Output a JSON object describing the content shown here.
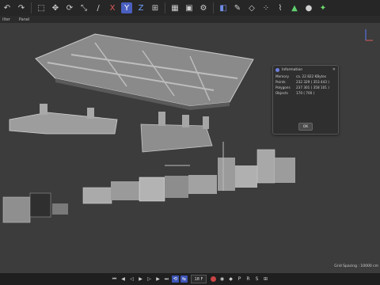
{
  "colors": {
    "toolbar_bg": "#262626",
    "viewport_bg": "#3c3c3c",
    "accent": "#4a5fbf",
    "record": "#c94444"
  },
  "toolbar": {
    "icons": [
      "undo-icon",
      "redo-icon",
      "selection-icon",
      "move-icon",
      "rotate-icon",
      "scale-icon",
      "brush-icon",
      "x-axis-icon",
      "y-axis-icon",
      "z-axis-icon",
      "coordinate-system-icon",
      "render-region-icon",
      "render-view-icon",
      "render-settings-icon",
      "cube-icon",
      "pen-icon",
      "subdivision-icon",
      "cloner-icon",
      "deformer-icon",
      "environment-icon",
      "camera-icon",
      "light-icon"
    ],
    "axis_x_label": "X",
    "axis_y_label": "Y",
    "axis_z_label": "Z"
  },
  "menubar": {
    "items": [
      "ilter",
      "Panel"
    ]
  },
  "viewport": {
    "grid_spacing_text": "Grid Spacing : 10000 cm"
  },
  "info_dialog": {
    "title": "Information",
    "rows": [
      {
        "key": "Memory",
        "value": "ca. 22 822 KBytes"
      },
      {
        "key": "Points",
        "value": "232 329 ( 353 443 )"
      },
      {
        "key": "Polygons",
        "value": "237 301 ( 358 101 )"
      },
      {
        "key": "Objects",
        "value": "170 ( 700 )"
      }
    ],
    "ok_label": "OK"
  },
  "bottom_bar": {
    "current_frame": "18 F"
  }
}
